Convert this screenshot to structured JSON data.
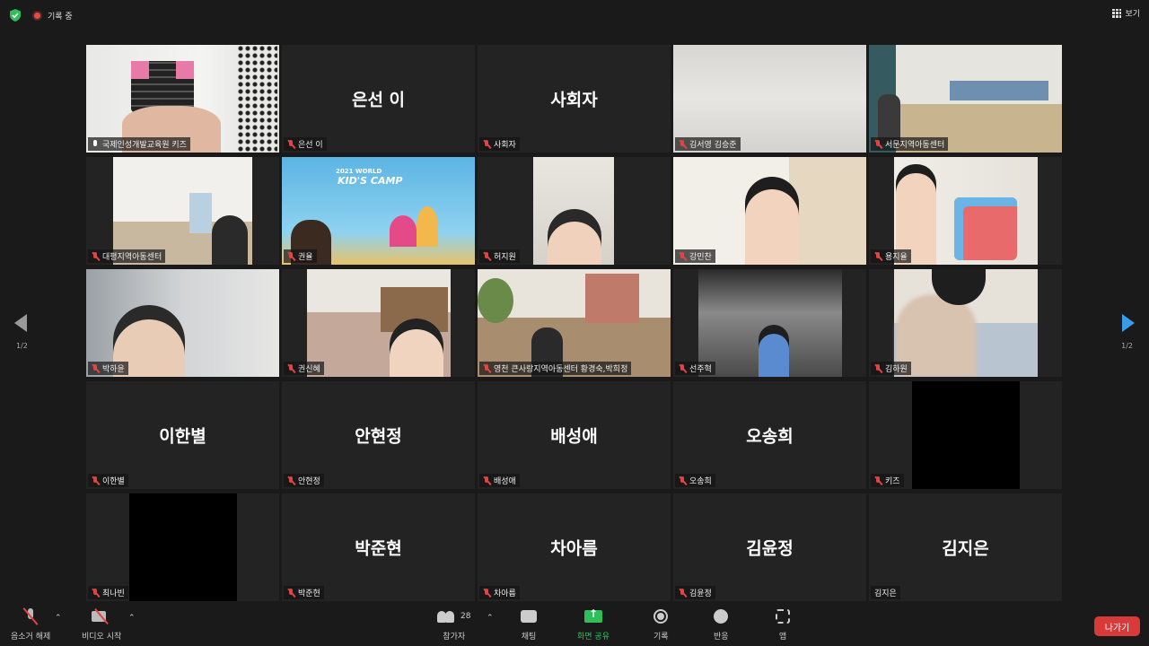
{
  "topbar": {
    "recording_label": "기록 중",
    "view_label": "보기"
  },
  "pagination": {
    "left": "1/2",
    "right": "1/2"
  },
  "tiles": [
    {
      "display": "",
      "label": "국제인성개발교육원 키즈",
      "type": "video",
      "scene": "hand-pixel-art",
      "active": true,
      "mic": "on"
    },
    {
      "display": "은선 이",
      "label": "은선 이",
      "type": "name"
    },
    {
      "display": "사회자",
      "label": "사회자",
      "type": "name"
    },
    {
      "display": "",
      "label": "김서영 김승준",
      "type": "video",
      "scene": "wall"
    },
    {
      "display": "",
      "label": "서문지역아동센터",
      "type": "video",
      "scene": "classroom"
    },
    {
      "display": "",
      "label": "대평지역아동센터",
      "type": "video",
      "scene": "room"
    },
    {
      "display": "",
      "label": "권율",
      "type": "video",
      "scene": "camp-banner"
    },
    {
      "display": "",
      "label": "허지원",
      "type": "video",
      "scene": "face-glasses"
    },
    {
      "display": "",
      "label": "강민찬",
      "type": "video",
      "scene": "face-boy"
    },
    {
      "display": "",
      "label": "용지율",
      "type": "video",
      "scene": "girl-blocks"
    },
    {
      "display": "",
      "label": "박하윤",
      "type": "video",
      "scene": "girl-headphones"
    },
    {
      "display": "",
      "label": "권신혜",
      "type": "video",
      "scene": "girl-room"
    },
    {
      "display": "",
      "label": "영천 큰사랑지역아동센터 황경숙,박희정",
      "type": "video",
      "scene": "center-room"
    },
    {
      "display": "",
      "label": "선주혁",
      "type": "video",
      "scene": "boy-small"
    },
    {
      "display": "",
      "label": "김하원",
      "type": "video",
      "scene": "girl-mask"
    },
    {
      "display": "이한별",
      "label": "이한별",
      "type": "name"
    },
    {
      "display": "안현정",
      "label": "안현정",
      "type": "name"
    },
    {
      "display": "배성애",
      "label": "배성애",
      "type": "name"
    },
    {
      "display": "오송희",
      "label": "오송희",
      "type": "name"
    },
    {
      "display": "",
      "label": "키즈",
      "type": "black"
    },
    {
      "display": "",
      "label": "최나빈",
      "type": "black"
    },
    {
      "display": "박준현",
      "label": "박준현",
      "type": "name"
    },
    {
      "display": "차아름",
      "label": "차아름",
      "type": "name"
    },
    {
      "display": "김윤정",
      "label": "김윤정",
      "type": "name"
    },
    {
      "display": "김지은",
      "label": "김지은",
      "type": "name",
      "mic": "none"
    }
  ],
  "camp_banner": {
    "line1": "2021 WORLD",
    "line2": "KID'S CAMP"
  },
  "toolbar": {
    "unmute": "음소거 해제",
    "start_video": "비디오 시작",
    "participants": "참가자",
    "participants_count": "28",
    "chat": "채팅",
    "share": "화면 공유",
    "record": "기록",
    "reactions": "반응",
    "apps": "앱",
    "leave": "나가기"
  },
  "colors": {
    "active_border": "#b8d85a",
    "share_green": "#2fbf5a",
    "leave_red": "#d83a3a",
    "nav_blue": "#3a9be8"
  }
}
